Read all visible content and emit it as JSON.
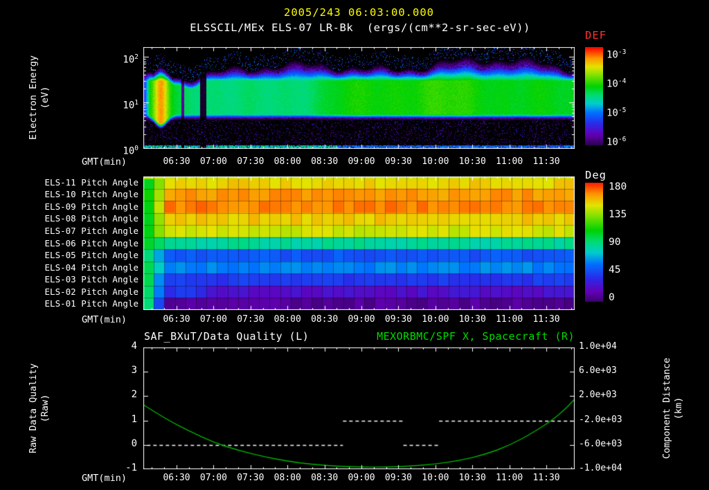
{
  "header": {
    "timestamp": "2005/243 06:03:00.000",
    "plot_title": "ELSSCIL/MEx ELS-07 LR-Bk  (ergs/(cm**2-sr-sec-eV))"
  },
  "colors": {
    "background": "#000000",
    "frame": "#ffffff",
    "timestamp_yellow": "#ffff00",
    "def_title_red": "#ff3232",
    "orbit_line": "#00b400",
    "orbit_title_green": "#00dc00",
    "quality_line": "#ffffff",
    "axis_text": "#ffffff"
  },
  "time_axis": {
    "label": "GMT(min)",
    "start_min": 363,
    "end_min": 713,
    "minor_step_min": 10,
    "major_ticks": [
      {
        "t": 390,
        "label": "06:30"
      },
      {
        "t": 420,
        "label": "07:00"
      },
      {
        "t": 450,
        "label": "07:30"
      },
      {
        "t": 480,
        "label": "08:00"
      },
      {
        "t": 510,
        "label": "08:30"
      },
      {
        "t": 540,
        "label": "09:00"
      },
      {
        "t": 570,
        "label": "09:30"
      },
      {
        "t": 600,
        "label": "10:00"
      },
      {
        "t": 630,
        "label": "10:30"
      },
      {
        "t": 660,
        "label": "11:00"
      },
      {
        "t": 690,
        "label": "11:30"
      }
    ]
  },
  "chart_data": [
    {
      "id": "electron-energy-spectrogram",
      "type": "heatmap",
      "instrument": "ELSSCIL/MEx ELS-07 LR-Bk",
      "units": "ergs/(cm**2-sr-sec-eV)",
      "ylabel_line1": "Electron Energy",
      "ylabel_line2": "(eV)",
      "yscale": "log",
      "ylim_ev": [
        1,
        170
      ],
      "ylim_log": [
        0,
        2.23
      ],
      "yticks": [
        {
          "base": "10",
          "exp": "2",
          "log10": 2
        },
        {
          "base": "10",
          "exp": "1",
          "log10": 1
        },
        {
          "base": "10",
          "exp": "0",
          "log10": 0
        }
      ],
      "colorbar_title": "DEF",
      "colorbar_ticks": [
        {
          "base": "10",
          "exp": "-3"
        },
        {
          "base": "10",
          "exp": "-4"
        },
        {
          "base": "10",
          "exp": "-5"
        },
        {
          "base": "10",
          "exp": "-6"
        }
      ],
      "band": {
        "low_edge_ev": 4.3,
        "core_ev": [
          6,
          30
        ],
        "top_edge_ev_range": [
          45,
          110
        ]
      },
      "features": [
        {
          "t0": 368,
          "t1": 386,
          "desc": "bright yellow enhancement extending down to ~3 eV"
        },
        {
          "t0": 394,
          "t1": 396,
          "desc": "narrow dark data gap"
        },
        {
          "t0": 409,
          "t1": 414,
          "desc": "data gap (dark column)"
        },
        {
          "t0": 363,
          "t1": 713,
          "desc": "sparse purple speckle below 4 eV, green band 5-70 eV"
        }
      ]
    },
    {
      "id": "pitch-angle-panel",
      "type": "heatmap",
      "rows": [
        {
          "label": "ELS-11 Pitch Angle",
          "deg": 150
        },
        {
          "label": "ELS-10 Pitch Angle",
          "deg": 162
        },
        {
          "label": "ELS-09 Pitch Angle",
          "deg": 166
        },
        {
          "label": "ELS-08 Pitch Angle",
          "deg": 152
        },
        {
          "label": "ELS-07 Pitch Angle",
          "deg": 143
        },
        {
          "label": "ELS-06 Pitch Angle",
          "deg": 84
        },
        {
          "label": "ELS-05 Pitch Angle",
          "deg": 48
        },
        {
          "label": "ELS-04 Pitch Angle",
          "deg": 60
        },
        {
          "label": "ELS-03 Pitch Angle",
          "deg": 40
        },
        {
          "label": "ELS-02 Pitch Angle",
          "deg": 22,
          "early_deg": 38,
          "early_until": 410
        },
        {
          "label": "ELS-01 Pitch Angle",
          "deg": 8
        }
      ],
      "left_start_deg": 100,
      "transition_end_min": 382,
      "colorbar_title": "Deg",
      "colorbar_ticks": [
        180,
        135,
        90,
        45,
        0
      ]
    },
    {
      "id": "quality-and-orbit",
      "type": "line",
      "title_left": "SAF_BXuT/Data Quality (L)",
      "title_right": "MEXORBMC/SPF X, Spacecraft (R)",
      "left_axis": {
        "label_line1": "Raw Data Quality",
        "label_line2": "(Raw)",
        "ticks": [
          4,
          3,
          2,
          1,
          0,
          -1
        ],
        "min": -1,
        "max": 4
      },
      "right_axis": {
        "label_line1": "Component Distance",
        "label_line2": "(km)",
        "ticks": [
          "1.0e+04",
          "6.0e+03",
          "2.0e+03",
          "-2.0e+03",
          "-6.0e+03",
          "-1.0e+04"
        ],
        "tick_values": [
          10000,
          6000,
          2000,
          -2000,
          -6000,
          -10000
        ],
        "min": -10000,
        "max": 10000
      },
      "quality_segments": [
        {
          "value": 0,
          "t0": 366,
          "t1": 525
        },
        {
          "value": 1,
          "t0": 525,
          "t1": 574
        },
        {
          "value": 0,
          "t0": 574,
          "t1": 603
        },
        {
          "value": 1,
          "t0": 603,
          "t1": 712
        }
      ],
      "orbit_series": {
        "name": "MEXORBMC/SPF X Spacecraft",
        "t_min": [
          363,
          380,
          400,
          420,
          440,
          460,
          480,
          500,
          520,
          540,
          560,
          580,
          600,
          620,
          640,
          660,
          680,
          695,
          705,
          713
        ],
        "km": [
          600,
          -1600,
          -3700,
          -5600,
          -6900,
          -7900,
          -8700,
          -9200,
          -9500,
          -9650,
          -9650,
          -9500,
          -9150,
          -8550,
          -7600,
          -6100,
          -3900,
          -1900,
          -200,
          1500
        ]
      }
    }
  ]
}
